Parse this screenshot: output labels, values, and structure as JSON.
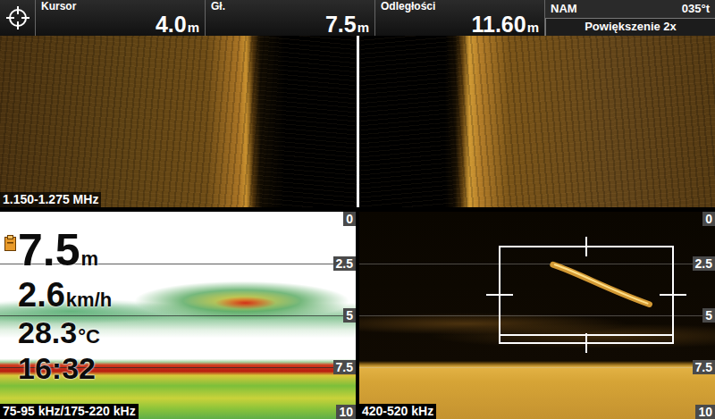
{
  "top_bar": {
    "fields": [
      {
        "kind": "reading",
        "label": "Kursor",
        "value": "4.0",
        "unit": "m"
      },
      {
        "kind": "reading",
        "label": "Gł.",
        "value": "7.5",
        "unit": "m"
      },
      {
        "kind": "reading",
        "label": "Odległości",
        "value": "11.60",
        "unit": "m"
      },
      {
        "kind": "heading",
        "label": "NAM",
        "value": "035°t",
        "sub": "Powiększenie 2x"
      }
    ]
  },
  "side_imaging": {
    "frequency": "1.150-1.275 MHz"
  },
  "sonar": {
    "frequency": "75-95 kHz/175-220 kHz",
    "scale": [
      "0",
      "2.5",
      "5",
      "7.5",
      "10"
    ],
    "readouts": [
      {
        "value": "7.5",
        "unit": "m"
      },
      {
        "value": "2.6",
        "unit": "km/h"
      },
      {
        "value": "28.3",
        "unit": "°C"
      },
      {
        "value": "16:32"
      }
    ]
  },
  "down_imaging": {
    "frequency": "420-520 kHz",
    "scale": [
      "0",
      "2.5",
      "5",
      "7.5",
      "10"
    ]
  }
}
